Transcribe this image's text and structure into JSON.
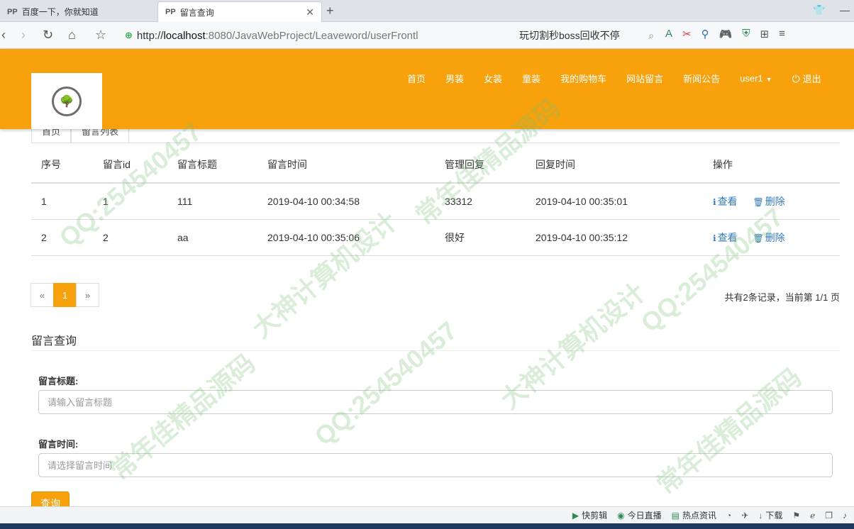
{
  "browser": {
    "tabs": [
      {
        "label": "百度一下，你就知道",
        "favicon": "PP"
      },
      {
        "label": "留言查询",
        "favicon": "PP"
      }
    ],
    "new_tab": "+",
    "url": {
      "prefix": "http://",
      "host": "localhost",
      "rest": ":8080/JavaWebProject/Leaveword/userFrontl"
    },
    "search_text": "玩切割秒boss回收不停"
  },
  "header": {
    "nav": [
      {
        "label": "首页"
      },
      {
        "label": "男装"
      },
      {
        "label": "女装"
      },
      {
        "label": "童装"
      },
      {
        "label": "我的购物车"
      },
      {
        "label": "网站留言"
      },
      {
        "label": "新闻公告"
      }
    ],
    "user": "user1",
    "logout": "退出",
    "accent": "#f7a10c"
  },
  "sub_tabs": [
    "首页",
    "留言列表"
  ],
  "table": {
    "headers": [
      "序号",
      "留言id",
      "留言标题",
      "留言时间",
      "管理回复",
      "回复时间",
      "操作"
    ],
    "rows": [
      {
        "no": "1",
        "id": "1",
        "title": "111",
        "time": "2019-04-10 00:34:58",
        "reply": "33312",
        "reply_time": "2019-04-10 00:35:01",
        "view": "查看",
        "delete": "删除"
      },
      {
        "no": "2",
        "id": "2",
        "title": "aa",
        "time": "2019-04-10 00:35:06",
        "reply": "很好",
        "reply_time": "2019-04-10 00:35:12",
        "view": "查看",
        "delete": "删除"
      }
    ]
  },
  "pagination": {
    "prev": "«",
    "current": "1",
    "next": "»",
    "info": "共有2条记录，当前第 1/1 页"
  },
  "search": {
    "section_title": "留言查询",
    "title_label": "留言标题:",
    "title_placeholder": "请输入留言标题",
    "time_label": "留言时间:",
    "time_placeholder": "请选择留言时间",
    "query_button": "查询"
  },
  "statusbar": {
    "items": [
      "快剪辑",
      "今日直播",
      "热点资讯",
      "下载"
    ]
  },
  "watermark": [
    "QQ:254540457",
    "大神计算机设计",
    "常年佳精品源码"
  ]
}
